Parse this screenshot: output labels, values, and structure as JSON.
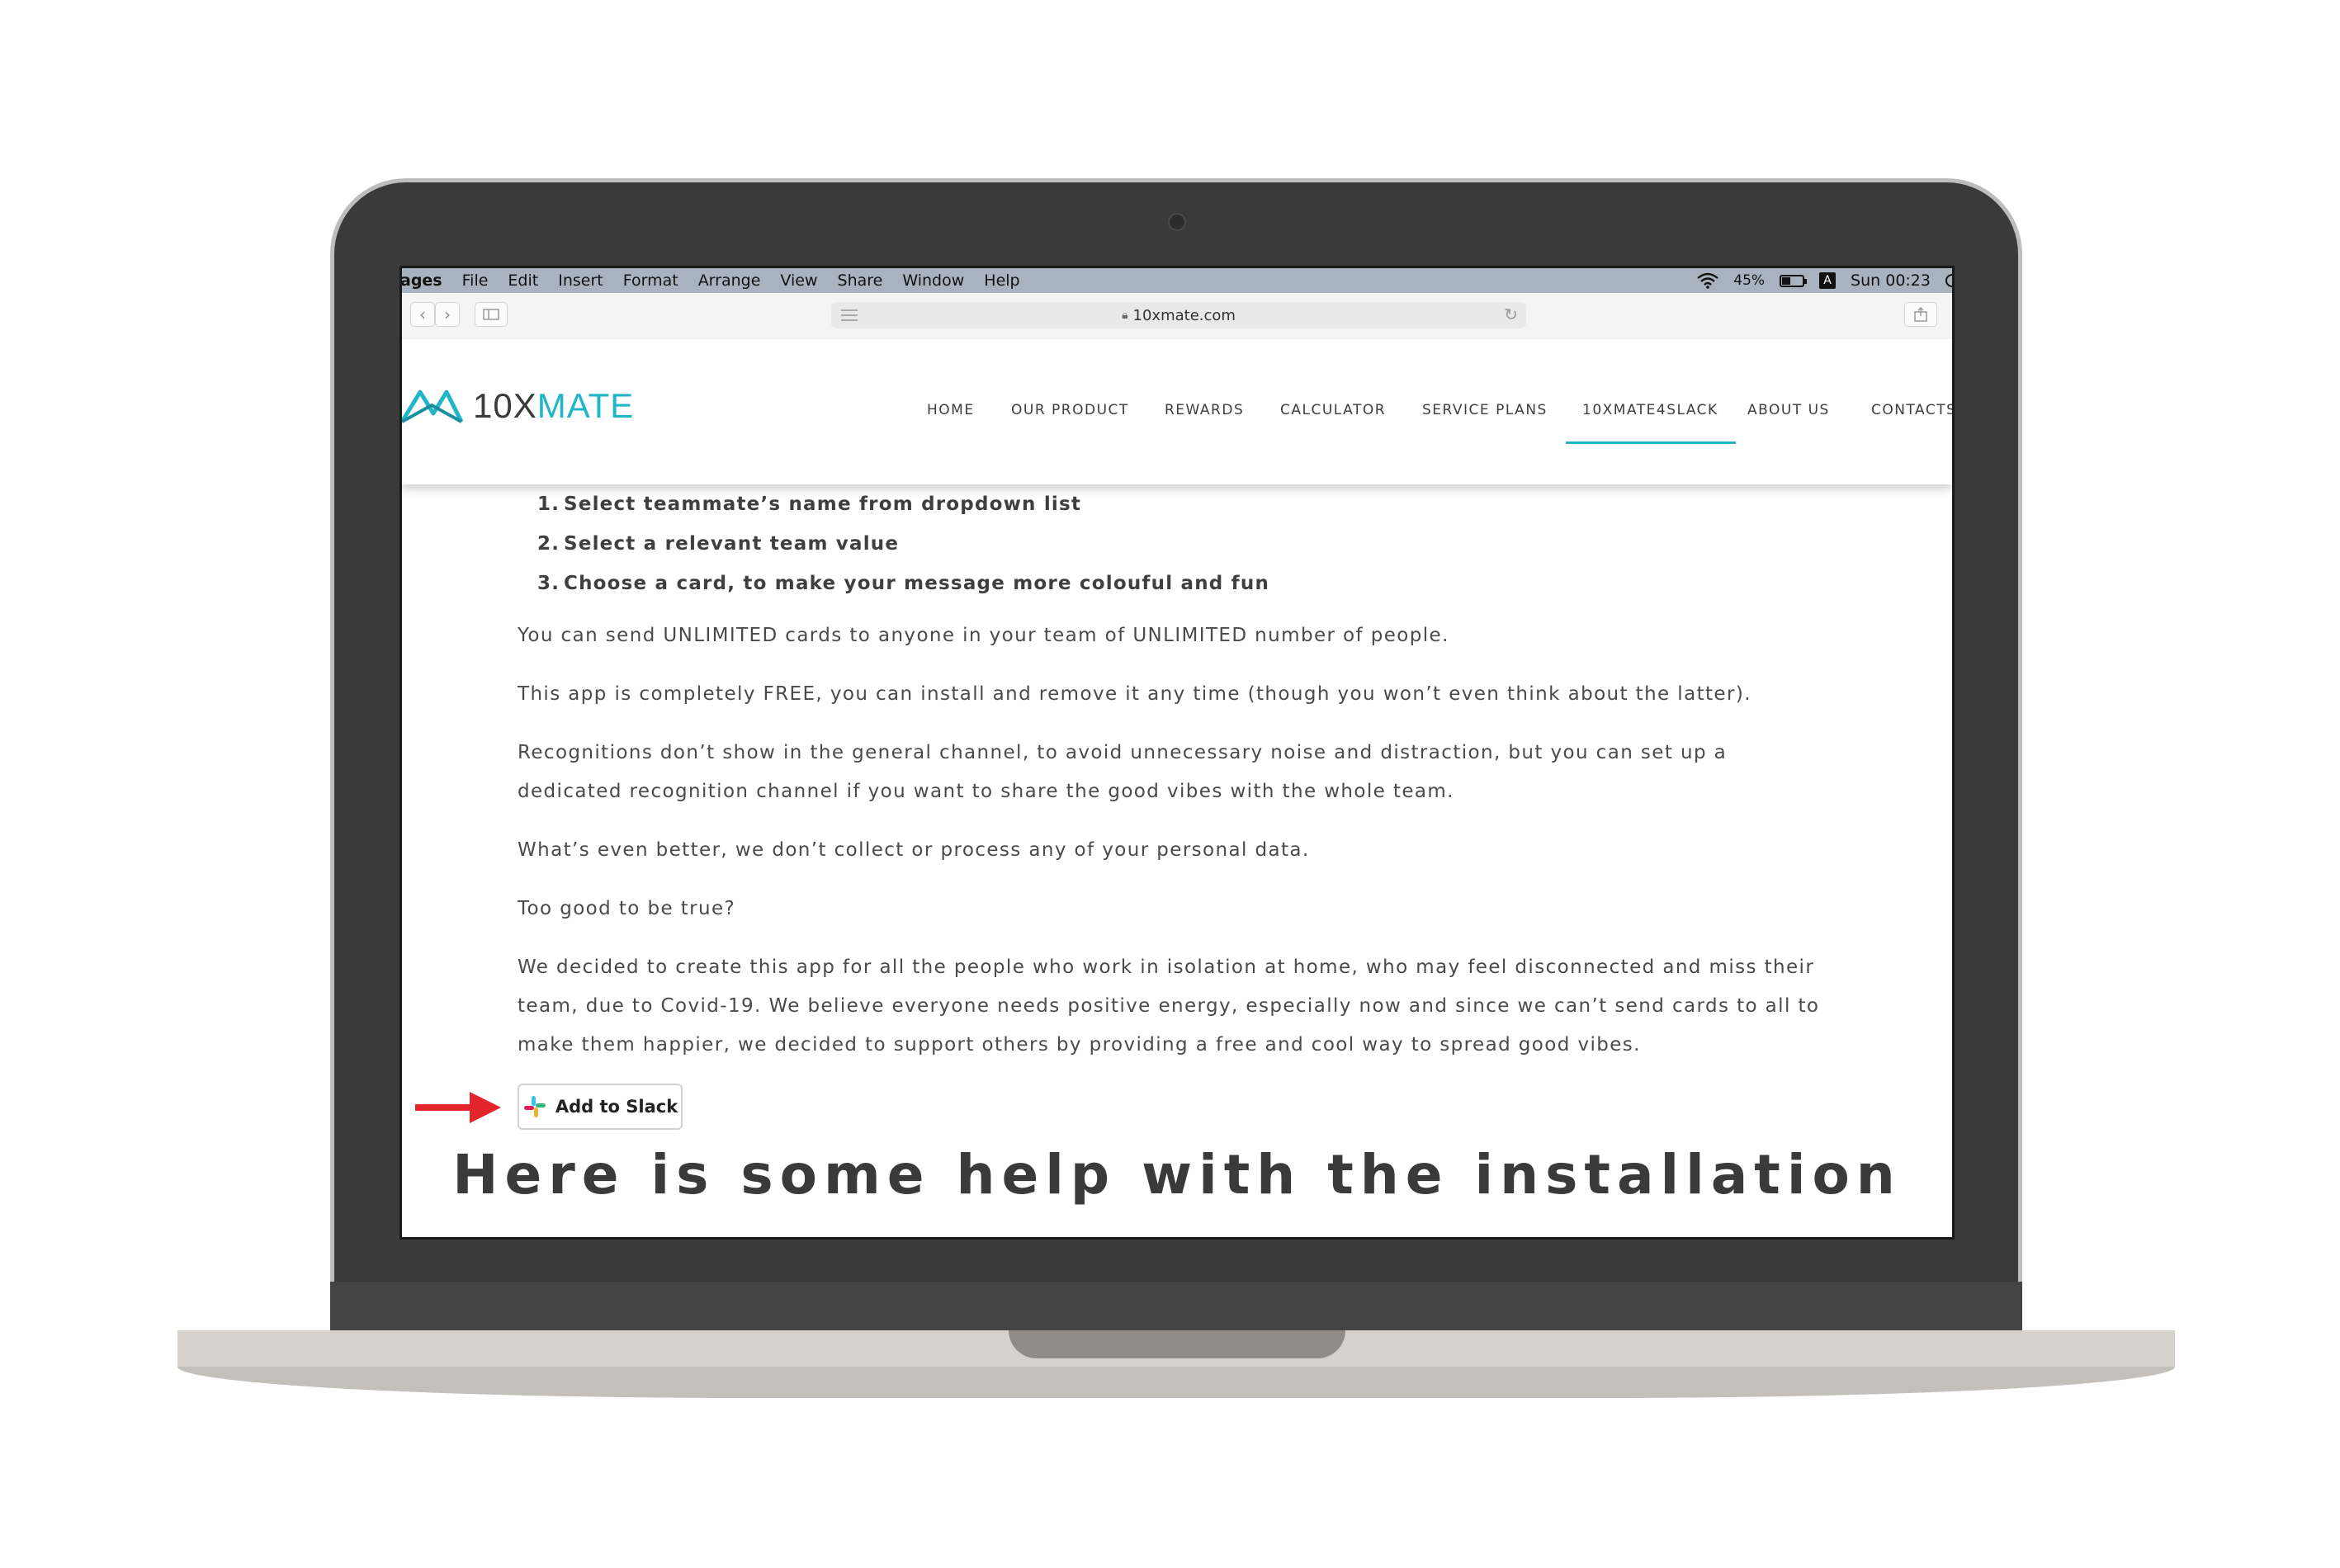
{
  "menubar": {
    "items": [
      "ages",
      "File",
      "Edit",
      "Insert",
      "Format",
      "Arrange",
      "View",
      "Share",
      "Window",
      "Help"
    ],
    "battery_percent": "45%",
    "input_source": "A",
    "clock": "Sun 00:23"
  },
  "browser": {
    "url": "10xmate.com",
    "back_icon": "chevron-left-icon",
    "forward_icon": "chevron-right-icon",
    "sidebar_icon": "sidebar-icon",
    "share_icon": "share-icon",
    "reload_icon": "reload-icon"
  },
  "site": {
    "logo_prefix": "10X",
    "logo_accent": "MATE",
    "nav": [
      "HOME",
      "OUR PRODUCT",
      "REWARDS",
      "CALCULATOR",
      "SERVICE PLANS",
      "10XMATE4SLACK",
      "ABOUT US",
      "CONTACTS"
    ],
    "active_nav": "10XMATE4SLACK",
    "accent_color": "#1fb6c8"
  },
  "content": {
    "steps": [
      {
        "num": "1.",
        "text": "Select teammate’s name from dropdown list"
      },
      {
        "num": "2.",
        "text": "Select a relevant team value"
      },
      {
        "num": "3.",
        "text": "Choose a card, to make your message more colouful and fun"
      }
    ],
    "paragraphs": [
      "You can send UNLIMITED cards to anyone in your team of UNLIMITED number of people.",
      "This app is completely FREE, you can install and remove it any time (though you won’t even think about the latter).",
      "Recognitions don’t show in the general channel, to avoid unnecessary noise and distraction, but you can set up a dedicated recognition channel if you want to share the good vibes with the whole team.",
      "What’s even better, we don’t collect or process any of your personal data.",
      "Too good to be true?",
      "We decided to create this app for all the people who work in isolation at home, who may feel disconnected and miss their team, due to Covid-19. We believe everyone needs positive energy, especially now and since we can’t send cards to all to make them happier, we decided to support others by providing a free and cool way to spread good vibes."
    ],
    "slack_button": "Add to Slack",
    "help_title": "Here is some help with the installation"
  }
}
